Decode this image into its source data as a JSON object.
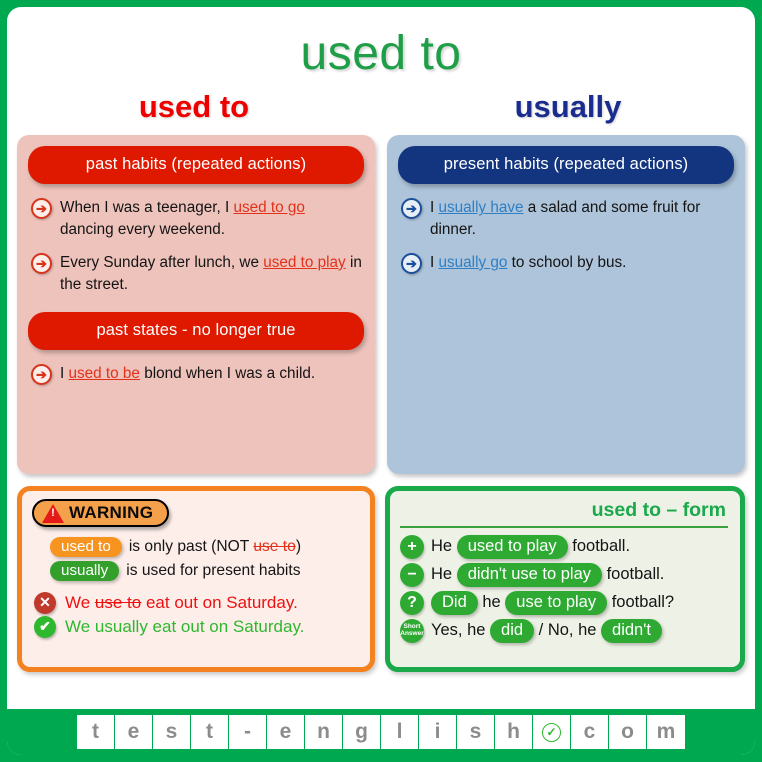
{
  "header": {
    "main_title": "used to",
    "left_subtitle": "used to",
    "right_subtitle": "usually",
    "colors": {
      "main_title": "#1f9e48",
      "left_subtitle": "#ee0000",
      "right_subtitle": "#1a2d8f",
      "frame": "#00a84f"
    }
  },
  "left_panel": {
    "background": "#eec3bc",
    "bar1": "past habits (repeated actions)",
    "bar1_color": "#de1900",
    "bullets": [
      {
        "icon": "arrow-right-icon",
        "pre": "When I was a teenager, I ",
        "highlight": "used to go",
        "post": " dancing every weekend."
      },
      {
        "icon": "arrow-right-icon",
        "pre": "Every Sunday after lunch, we ",
        "highlight": "used to play",
        "post": " in the street."
      }
    ],
    "bar2": "past states - no longer true",
    "bar2_color": "#de1900",
    "bullets2": [
      {
        "icon": "arrow-right-icon",
        "pre": "I ",
        "highlight": "used to be",
        "post": " blond when I was a child."
      }
    ]
  },
  "right_panel": {
    "background": "#adc4da",
    "bar1": "present habits (repeated actions)",
    "bar1_color": "#13357f",
    "bullets": [
      {
        "icon": "arrow-right-icon",
        "pre": "I ",
        "highlight": "usually have",
        "post": " a salad and some fruit for dinner."
      },
      {
        "icon": "arrow-right-icon",
        "pre": "I ",
        "highlight": "usually go",
        "post": " to school by bus."
      }
    ]
  },
  "warning_box": {
    "border_color": "#f58220",
    "background": "#fdeeea",
    "badge_label": "WARNING",
    "badge_icon": "warning-triangle-icon",
    "badge_background": "#f5a04a",
    "rules": [
      {
        "pill": "used to",
        "pill_color": "#f79420",
        "text_before": " is only past (NOT ",
        "struck": "use to",
        "text_after": ")"
      },
      {
        "pill": "usually",
        "pill_color": "#34a02c",
        "text_before": " is used for present habits",
        "struck": "",
        "text_after": ""
      }
    ],
    "examples": [
      {
        "icon": "cross-circle-icon",
        "icon_color": "#c0392b",
        "type": "incorrect",
        "pre": "We ",
        "struck": "use to",
        "post": " eat out on Saturday.",
        "text_color": "#ee1111"
      },
      {
        "icon": "check-circle-icon",
        "icon_color": "#2eb82e",
        "type": "correct",
        "pre": "We usually eat out on Saturday.",
        "struck": "",
        "post": "",
        "text_color": "#2eb82e"
      }
    ]
  },
  "form_box": {
    "border_color": "#1aa94b",
    "background": "#eef2e6",
    "title": "used to – form",
    "title_color": "#1aa94b",
    "rows": [
      {
        "icon": "plus-circle-icon",
        "icon_label": "+",
        "pre": "He ",
        "pill": "used to play",
        "mid": "",
        "pill2": "",
        "post": " football."
      },
      {
        "icon": "minus-circle-icon",
        "icon_label": "−",
        "pre": "He ",
        "pill": "didn't use to play",
        "mid": "",
        "pill2": "",
        "post": " football."
      },
      {
        "icon": "question-circle-icon",
        "icon_label": "?",
        "pre": "",
        "pill": "Did",
        "mid": " he ",
        "pill2": "use to play",
        "post": " football?"
      },
      {
        "icon": "short-answer-icon",
        "icon_label": "Short Answer",
        "pre": "Yes, he ",
        "pill": "did",
        "mid": " / No, he ",
        "pill2": "didn't",
        "post": ""
      }
    ]
  },
  "footer": {
    "background": "#00a84f",
    "tiles": [
      "t",
      "e",
      "s",
      "t",
      "-",
      "e",
      "n",
      "g",
      "l",
      "i",
      "s",
      "h",
      "✅",
      "c",
      "o",
      "m"
    ],
    "logo_index": 12,
    "logo_icon": "check-circle-logo-icon"
  }
}
